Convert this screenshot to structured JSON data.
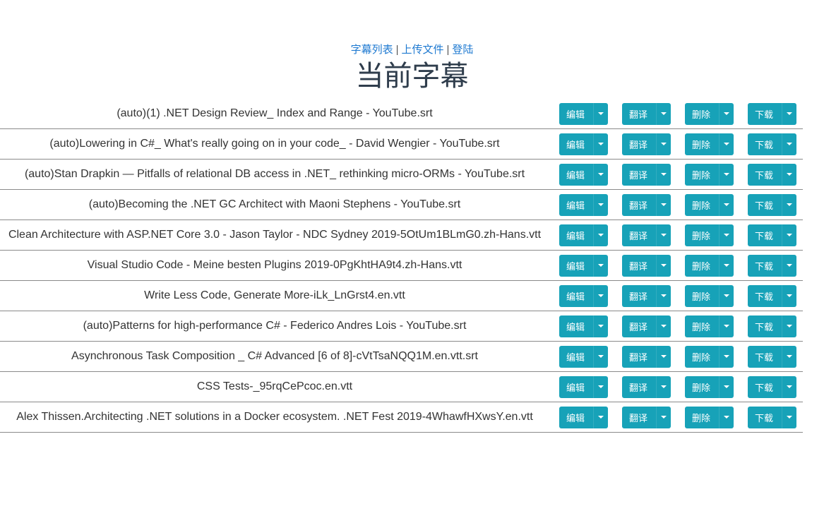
{
  "nav": {
    "links": [
      "字幕列表",
      "上传文件",
      "登陆"
    ],
    "separator": "|"
  },
  "page_title": "当前字幕",
  "actions": {
    "edit": "编辑",
    "translate": "翻译",
    "delete": "删除",
    "download": "下载"
  },
  "subtitles": [
    "(auto)(1) .NET Design Review_ Index and Range - YouTube.srt",
    "(auto)Lowering in C#_ What's really going on in your code_ - David Wengier - YouTube.srt",
    "(auto)Stan Drapkin — Pitfalls of relational DB access in .NET_ rethinking micro-ORMs - YouTube.srt",
    "(auto)Becoming the .NET GC Architect with Maoni Stephens - YouTube.srt",
    "Clean Architecture with ASP.NET Core 3.0 - Jason Taylor - NDC Sydney 2019-5OtUm1BLmG0.zh-Hans.vtt",
    "Visual Studio Code - Meine besten Plugins 2019-0PgKhtHA9t4.zh-Hans.vtt",
    "Write Less Code, Generate More-iLk_LnGrst4.en.vtt",
    "(auto)Patterns for high-performance C# - Federico Andres Lois - YouTube.srt",
    "Asynchronous Task Composition _ C# Advanced [6 of 8]-cVtTsaNQQ1M.en.vtt.srt",
    "CSS Tests-_95rqCePcoc.en.vtt",
    "Alex Thissen.Architecting .NET solutions in a Docker ecosystem. .NET Fest 2019-4WhawfHXwsY.en.vtt"
  ],
  "colors": {
    "button": "#17a2b8",
    "link": "#1f7ad1",
    "title": "#2f3d4c"
  }
}
